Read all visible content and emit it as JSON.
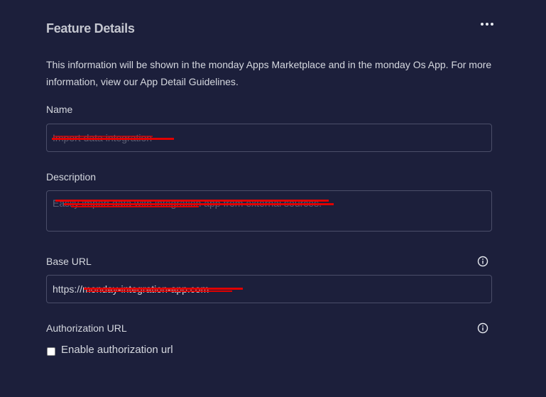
{
  "section": {
    "title": "Feature Details",
    "more_icon": "more-horizontal-icon",
    "description_line1": "This information will be shown in the monday Apps Marketplace and in the monday Os App. For more",
    "description_line2_prefix": "information, view our ",
    "description_link": "App Detail Guidelines",
    "description_line2_suffix": "."
  },
  "fields": {
    "name": {
      "label": "Name",
      "value": "Import data integration"
    },
    "description": {
      "label": "Description",
      "value": "Easily import data with integration app from external sources."
    },
    "base_url": {
      "label": "Base URL",
      "value": "https://monday-integration-app.com",
      "info_icon": "info-icon"
    },
    "authorization_url": {
      "label": "Authorization URL",
      "info_icon": "info-icon",
      "checkbox_label": "Enable authorization url",
      "checked": false
    }
  },
  "colors": {
    "background": "#1c1f3b",
    "border": "#4b4e69",
    "text": "#d5d8df",
    "redaction": "#e00000"
  }
}
